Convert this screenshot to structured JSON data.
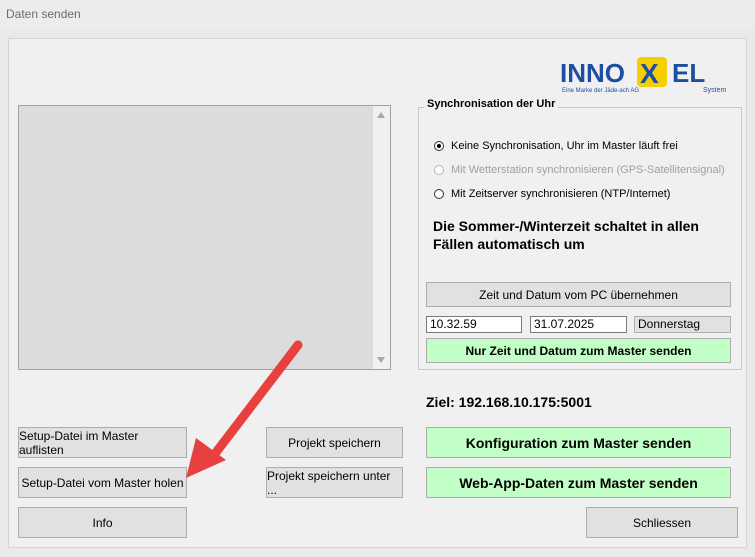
{
  "window": {
    "title": "Daten senden"
  },
  "logo": {
    "brand_left": "INNO",
    "brand_mid": "X",
    "brand_right": "EL",
    "tagline": "Eine Marke der Jäde-ach AG",
    "system": "System"
  },
  "sync": {
    "title": "Synchronisation der Uhr",
    "options": [
      {
        "label": "Keine Synchronisation, Uhr im Master läuft frei",
        "selected": true,
        "enabled": true
      },
      {
        "label": "Mit Wetterstation synchronisieren (GPS-Satellitensignal)",
        "selected": false,
        "enabled": false
      },
      {
        "label": "Mit Zeitserver synchronisieren (NTP/Internet)",
        "selected": false,
        "enabled": true
      }
    ],
    "note": "Die Sommer-/Winterzeit schaltet in allen Fällen automatisch um",
    "take_pc_time_label": "Zeit und Datum vom PC übernehmen",
    "time_value": "10.32.59",
    "date_value": "31.07.2025",
    "weekday_value": "Donnerstag",
    "send_time_label": "Nur Zeit und Datum zum Master senden"
  },
  "target": {
    "label": "Ziel: 192.168.10.175:5001"
  },
  "buttons": {
    "setup_list": "Setup-Datei im Master auflisten",
    "setup_fetch": "Setup-Datei vom Master holen",
    "info": "Info",
    "project_save": "Projekt speichern",
    "project_save_as": "Projekt speichern unter ...",
    "send_config": "Konfiguration zum Master senden",
    "send_webapp": "Web-App-Daten zum Master senden",
    "close": "Schliessen"
  },
  "colors": {
    "green_button": "#c2ffc6",
    "arrow_annotation": "#e8403f",
    "logo_blue": "#1c4fa1",
    "logo_yellow": "#f5d000"
  }
}
